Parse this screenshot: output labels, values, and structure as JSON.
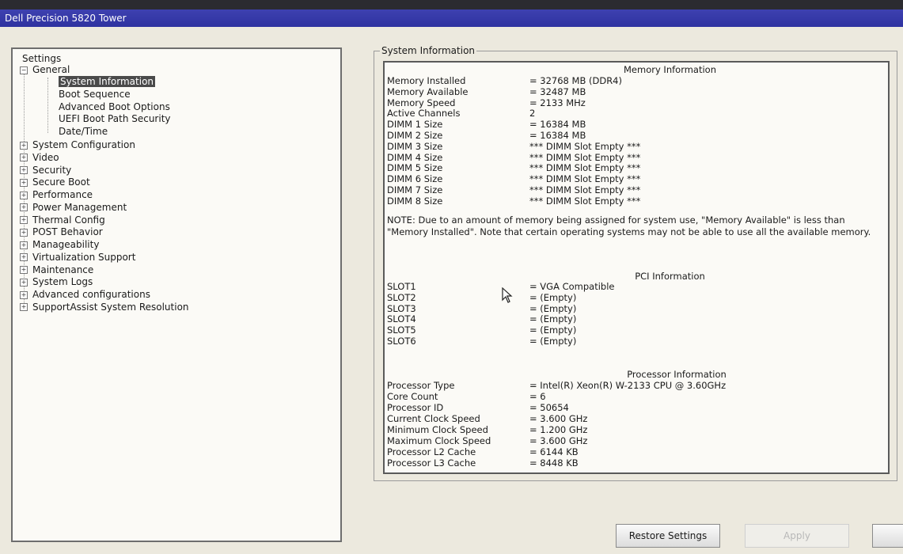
{
  "window": {
    "title": "Dell Precision 5820 Tower"
  },
  "tree": {
    "root": "Settings",
    "general": {
      "label": "General",
      "children": [
        "System Information",
        "Boot Sequence",
        "Advanced Boot Options",
        "UEFI Boot Path Security",
        "Date/Time"
      ]
    },
    "items": [
      "System Configuration",
      "Video",
      "Security",
      "Secure Boot",
      "Performance",
      "Power Management",
      "Thermal Config",
      "POST Behavior",
      "Manageability",
      "Virtualization Support",
      "Maintenance",
      "System Logs",
      "Advanced configurations",
      "SupportAssist System Resolution"
    ]
  },
  "panel": {
    "legend": "System Information",
    "memory": {
      "title": "Memory Information",
      "rows": [
        [
          "Memory Installed",
          "= 32768 MB (DDR4)"
        ],
        [
          "Memory Available",
          "= 32487 MB"
        ],
        [
          "Memory Speed",
          "= 2133 MHz"
        ],
        [
          "Active Channels",
          "2"
        ],
        [
          "DIMM 1 Size",
          "= 16384 MB"
        ],
        [
          "DIMM 2 Size",
          "= 16384 MB"
        ],
        [
          "DIMM 3 Size",
          "*** DIMM Slot Empty ***"
        ],
        [
          "DIMM 4 Size",
          "*** DIMM Slot Empty ***"
        ],
        [
          "DIMM 5 Size",
          "*** DIMM Slot Empty ***"
        ],
        [
          "DIMM 6 Size",
          "*** DIMM Slot Empty ***"
        ],
        [
          "DIMM 7 Size",
          "*** DIMM Slot Empty ***"
        ],
        [
          "DIMM 8 Size",
          "*** DIMM Slot Empty ***"
        ]
      ],
      "note": "NOTE: Due to an amount of memory being assigned for system use, \"Memory Available\" is less than \"Memory Installed\". Note that certain operating systems may not be able to use all the available memory."
    },
    "pci": {
      "title": "PCI Information",
      "rows": [
        [
          "SLOT1",
          "= VGA Compatible"
        ],
        [
          "SLOT2",
          "= (Empty)"
        ],
        [
          "SLOT3",
          "= (Empty)"
        ],
        [
          "SLOT4",
          "= (Empty)"
        ],
        [
          "SLOT5",
          "= (Empty)"
        ],
        [
          "SLOT6",
          "= (Empty)"
        ]
      ]
    },
    "processor": {
      "title": "Processor Information",
      "rows": [
        [
          "Processor Type",
          "= Intel(R) Xeon(R) W-2133 CPU @ 3.60GHz"
        ],
        [
          "Core Count",
          "= 6"
        ],
        [
          "Processor ID",
          "= 50654"
        ],
        [
          "Current Clock Speed",
          "= 3.600 GHz"
        ],
        [
          "Minimum Clock Speed",
          "= 1.200 GHz"
        ],
        [
          "Maximum Clock Speed",
          "= 3.600 GHz"
        ],
        [
          "Processor L2 Cache",
          "= 6144 KB"
        ],
        [
          "Processor L3 Cache",
          "= 8448 KB"
        ]
      ]
    }
  },
  "buttons": {
    "restore": "Restore Settings",
    "apply": "Apply",
    "exit": ""
  },
  "toggle_glyphs": {
    "expand": "+",
    "collapse": "−"
  }
}
